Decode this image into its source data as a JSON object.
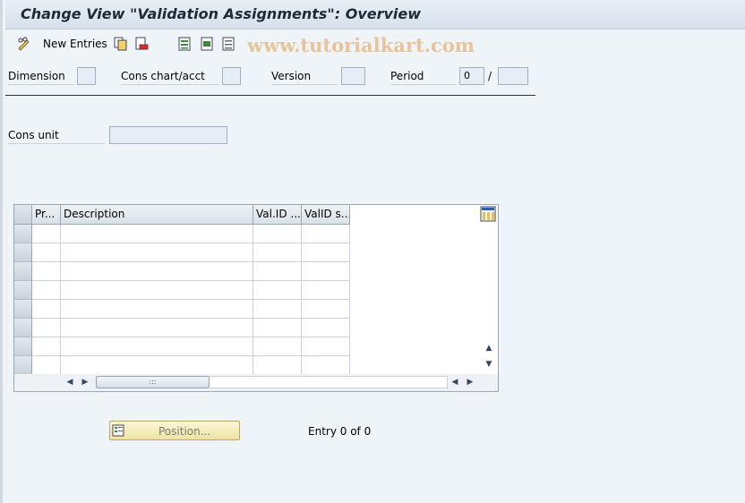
{
  "title": "Change View \"Validation Assignments\": Overview",
  "toolbar": {
    "new_entries_label": "New Entries",
    "watermark": "www.tutorialkart.com",
    "icons": [
      "glasses-pencil-icon",
      "copy-icon",
      "delete-icon",
      "select-all-icon",
      "select-block-icon",
      "deselect-icon"
    ]
  },
  "header_fields": {
    "dimension": {
      "label": "Dimension",
      "value": ""
    },
    "cons_chart": {
      "label": "Cons chart/acct",
      "value": ""
    },
    "version": {
      "label": "Version",
      "value": ""
    },
    "period": {
      "label": "Period",
      "value": "0",
      "separator": "/",
      "year": ""
    }
  },
  "cons_unit": {
    "label": "Cons unit",
    "value": ""
  },
  "table": {
    "columns": [
      "Pr...",
      "Description",
      "Val.ID ...",
      "ValID s..."
    ],
    "rows": [
      [
        "",
        "",
        "",
        ""
      ],
      [
        "",
        "",
        "",
        ""
      ],
      [
        "",
        "",
        "",
        ""
      ],
      [
        "",
        "",
        "",
        ""
      ],
      [
        "",
        "",
        "",
        ""
      ],
      [
        "",
        "",
        "",
        ""
      ],
      [
        "",
        "",
        "",
        ""
      ],
      [
        "",
        "",
        "",
        ""
      ]
    ],
    "hscroll_thumb": ":::"
  },
  "position_button": {
    "label": "Position..."
  },
  "entry_text": "Entry 0 of 0",
  "colors": {
    "accent": "#1c2a3a",
    "button_bg": "#efe3a4",
    "window_bg": "#eff4f9"
  }
}
